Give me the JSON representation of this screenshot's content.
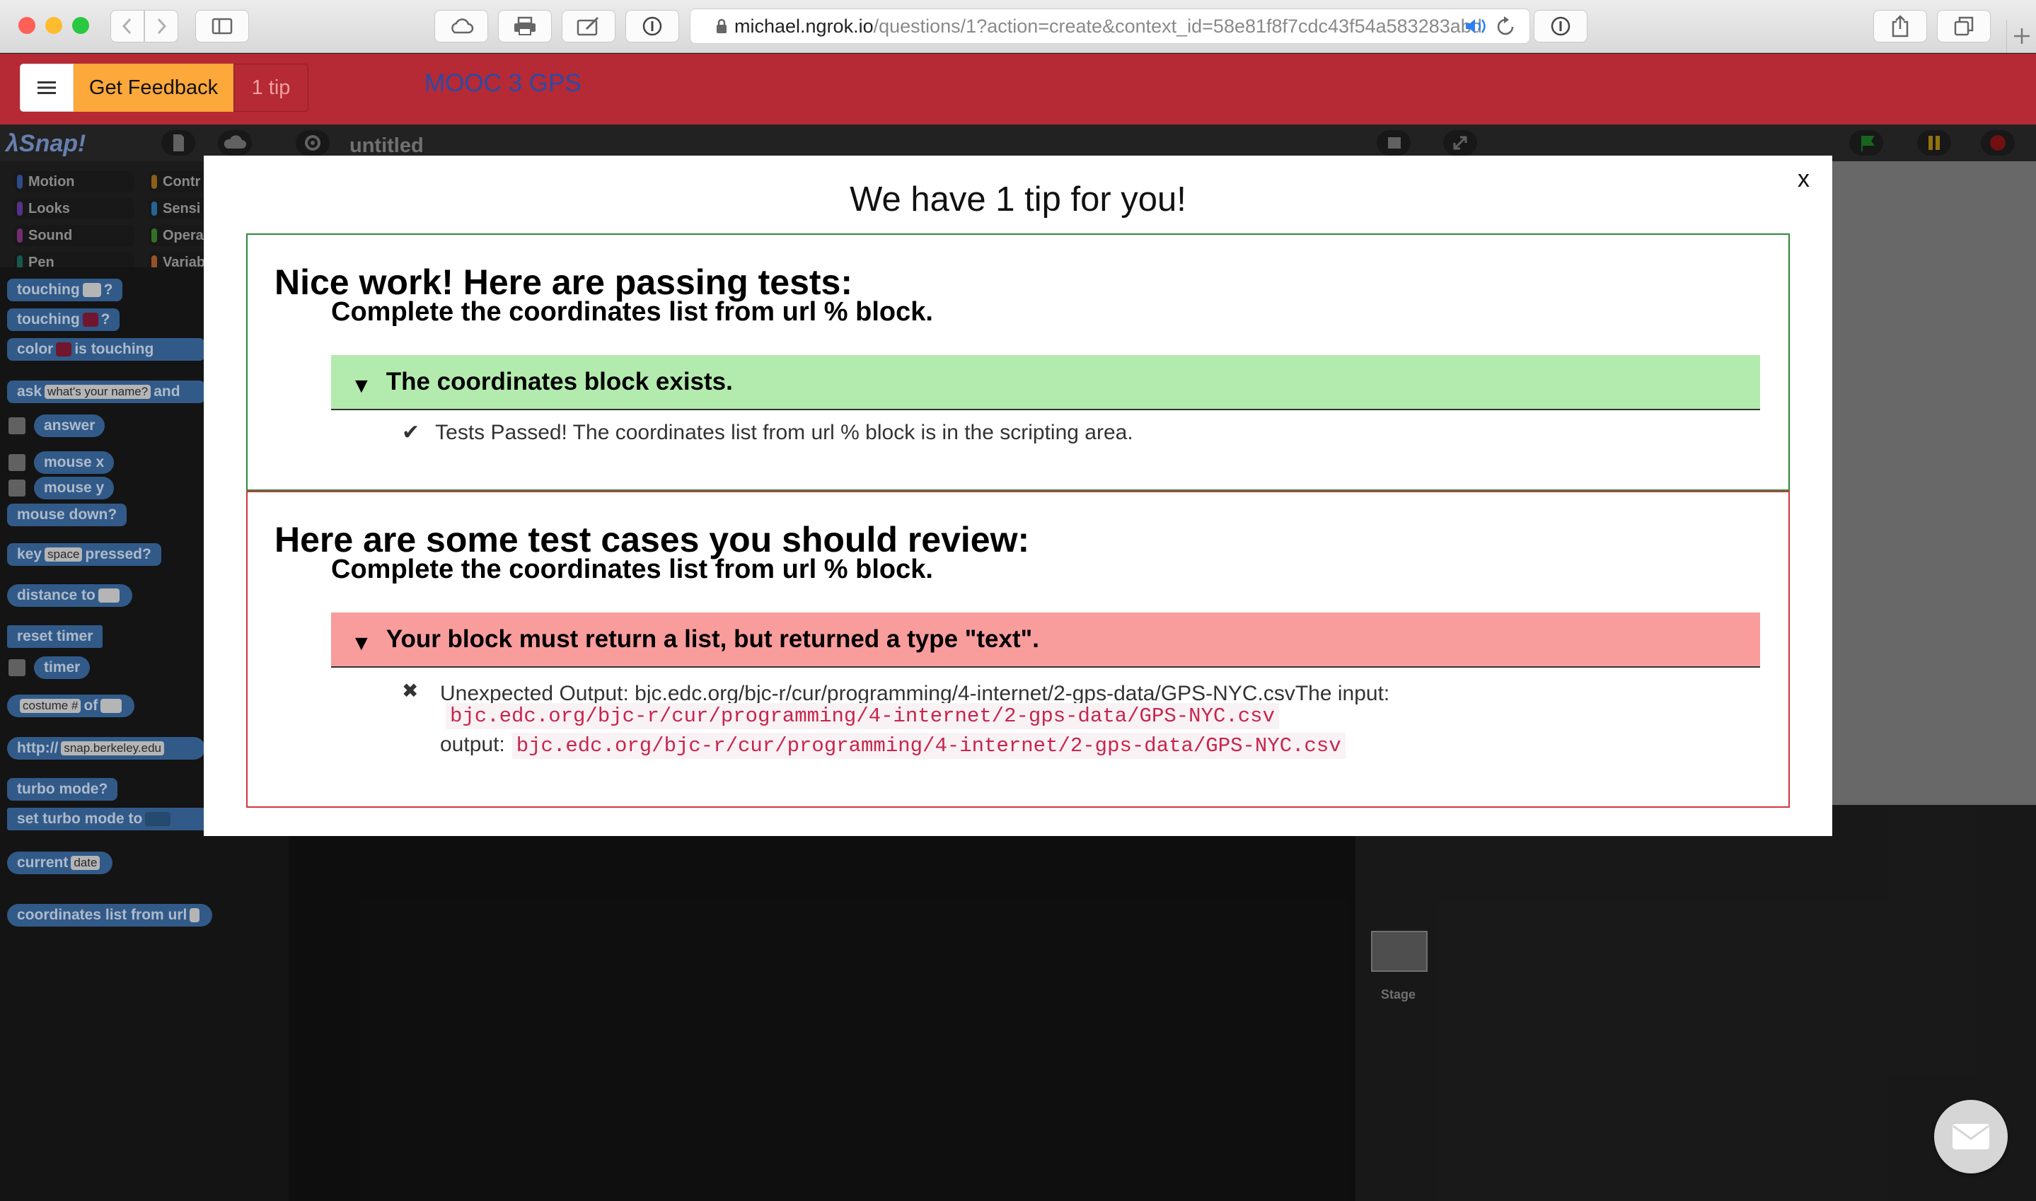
{
  "browser": {
    "url_host": "michael.ngrok.io",
    "url_path": "/questions/1?action=create&context_id=58e81f8f7cdc43f54a583283abd"
  },
  "header": {
    "feedback_label": "Get Feedback",
    "tip_count_label": "1 tip",
    "title": "MOOC 3 GPS"
  },
  "snap": {
    "project_name": "untitled",
    "categories": [
      "Motion",
      "Looks",
      "Sound",
      "Pen",
      "Contr",
      "Sensi",
      "Opera",
      "Variab"
    ],
    "blocks": {
      "touching1": "touching",
      "touching2": "touching",
      "color": "color",
      "is_touching": "is touching",
      "ask": "ask",
      "ask_input": "what's your name?",
      "ask_and": "and",
      "answer": "answer",
      "mouse_x": "mouse x",
      "mouse_y": "mouse y",
      "mouse_down": "mouse down?",
      "key": "key",
      "key_input": "space",
      "pressed": "pressed?",
      "distance_to": "distance to",
      "reset_timer": "reset timer",
      "timer": "timer",
      "costume_input": "costume #",
      "of": "of",
      "http": "http://",
      "http_input": "snap.berkeley.edu",
      "turbo_mode": "turbo mode?",
      "set_turbo": "set turbo mode to",
      "current": "current",
      "current_input": "date",
      "coordinates": "coordinates list from url"
    },
    "stage_label": "Stage"
  },
  "modal": {
    "close_label": "x",
    "title": "We have 1 tip for you!",
    "pass_section": {
      "heading": "Nice work! Here are passing tests:",
      "subheading": "Complete the coordinates list from url % block.",
      "test_title": "The coordinates block exists.",
      "result_icon": "✔",
      "result_text": "Tests Passed! The coordinates list from url % block is in the scripting area."
    },
    "review_section": {
      "heading": "Here are some test cases you should review:",
      "subheading": "Complete the coordinates list from url % block.",
      "test_title": "Your block must return a list, but returned a type \"text\".",
      "result_icon": "✖",
      "unexpected_text": "Unexpected Output: bjc.edc.org/bjc-r/cur/programming/4-internet/2-gps-data/GPS-NYC.csvThe input:",
      "input_value": "bjc.edc.org/bjc-r/cur/programming/4-internet/2-gps-data/GPS-NYC.csv",
      "output_label": "output:",
      "output_value": "bjc.edc.org/bjc-r/cur/programming/4-internet/2-gps-data/GPS-NYC.csv"
    }
  },
  "colors": {
    "header_red": "#b52a34",
    "feedback_orange": "#fda83a",
    "pass_green": "#b2ebad",
    "fail_red": "#f99c9c",
    "title_blue": "#2b4aa8"
  }
}
